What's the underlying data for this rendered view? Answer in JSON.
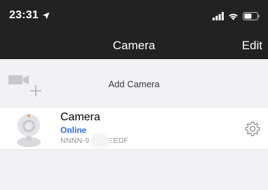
{
  "status_bar": {
    "time": "23:31",
    "icons": [
      "location-arrow-icon",
      "signal-icon",
      "wifi-icon",
      "battery-icon"
    ]
  },
  "nav": {
    "title": "Camera",
    "edit_label": "Edit"
  },
  "add_camera": {
    "icon": "add-camera-icon",
    "label": "Add Camera"
  },
  "cameras": [
    {
      "name": "Camera",
      "status": "Online",
      "device_id": "NNNN-9      99-EEEDF",
      "thumbnail": "camera-device-icon",
      "settings_icon": "gear-icon"
    }
  ],
  "colors": {
    "top_bar": "#222222",
    "background": "#f2f2f4",
    "online_status": "#2f6fd3"
  }
}
